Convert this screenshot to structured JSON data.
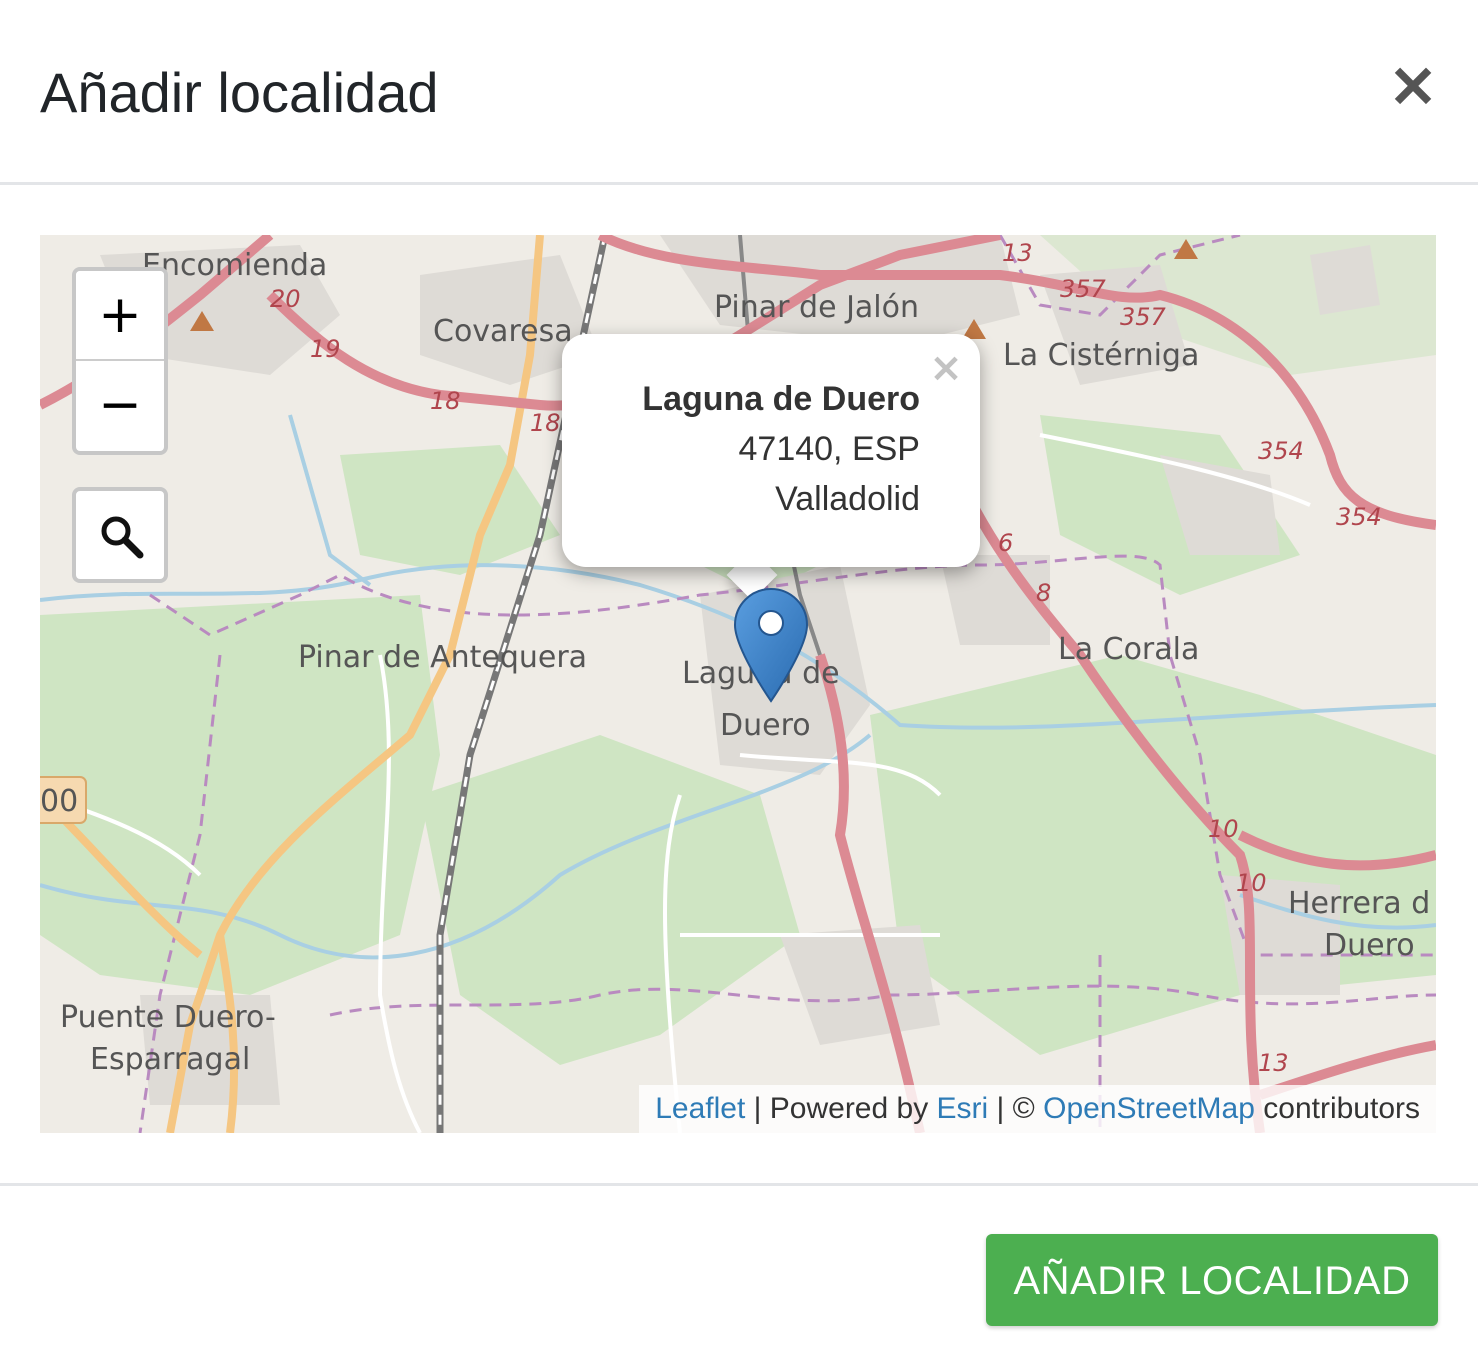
{
  "modal": {
    "title": "Añadir localidad",
    "close_symbol": "✕",
    "submit_label": "AÑADIR LOCALIDAD"
  },
  "map": {
    "zoom_in": "+",
    "zoom_out": "−",
    "search_icon": "search-icon",
    "popup": {
      "close_symbol": "×",
      "name": "Laguna de Duero",
      "postal_country": "47140, ESP",
      "province": "Valladolid"
    },
    "marker_icon": "map-marker-icon",
    "place_labels": {
      "encomienda": "Encomienda",
      "covaresa": "Covaresa",
      "pinar_jalon": "Pinar de Jalón",
      "la_cisterniga": "La Cistérniga",
      "pinar_antequera": "Pinar de Antequera",
      "laguna_1": "Laguna de",
      "laguna_2": "Duero",
      "la_corala": "La Corala",
      "herrera_1": "Herrera d",
      "herrera_2": "Duero",
      "puente_1": "Puente Duero-",
      "puente_2": "Esparragal",
      "shield_00": "00"
    },
    "road_numbers": {
      "r20": "20",
      "r19": "19",
      "r18a": "18",
      "r18b": "18",
      "r13a": "13",
      "r357a": "357",
      "r357b": "357",
      "r354a": "354",
      "r354b": "354",
      "r6": "6",
      "r8": "8",
      "r10a": "10",
      "r10b": "10",
      "r13b": "13"
    },
    "attribution": {
      "leaflet": "Leaflet",
      "sep1": " | Powered by ",
      "esri": "Esri",
      "sep2": " | © ",
      "osm": "OpenStreetMap",
      "suffix": " contributors"
    },
    "colors": {
      "land": "#efece6",
      "forest": "#cfe5c3",
      "urban": "#dedbd6",
      "primary_road": "#dc8a93",
      "secondary_road": "#f5c682",
      "water": "#a9cfe3",
      "boundary": "#b98ac0",
      "railway": "#777777",
      "marker": "#3a82c9",
      "button": "#4caf50"
    }
  }
}
